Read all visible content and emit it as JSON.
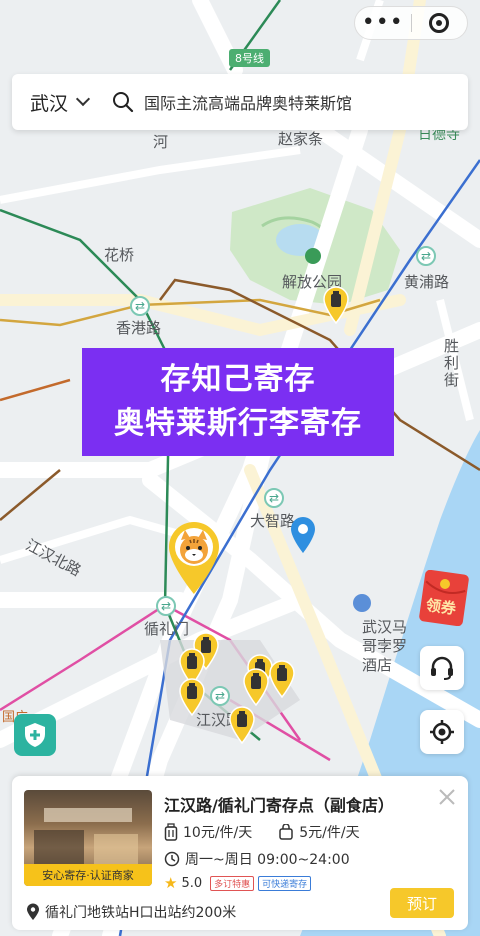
{
  "top_control": {
    "more_icon": "more-dots-icon",
    "close_icon": "target-circle-icon"
  },
  "search": {
    "city": "武汉",
    "query": "国际主流高端品牌奥特莱斯馆"
  },
  "map": {
    "labels": {
      "metro_line8": "8号线",
      "zhaojiatiao": "赵家条",
      "huaqiao": "花桥",
      "jiefang_park": "解放公园",
      "huangpu_road": "黄浦路",
      "xianggang_road": "香港路",
      "dazhi_road": "大智路",
      "jianghan_north": "江汉北路",
      "xunlimen": "循礼门",
      "jianghan_road": "江汉路",
      "wuhan_hotel": "武汉马哥孛罗酒店",
      "shengli_street": "胜利街",
      "river": "河",
      "left_guang": "国广",
      "right_top": "日德寺"
    }
  },
  "banner": {
    "line1": "存知己寄存",
    "line2": "奥特莱斯行李寄存"
  },
  "coupon": {
    "label": "领券"
  },
  "card": {
    "store_name": "江汉路/循礼门寄存点（副食店）",
    "cert_badge": "安心寄存·认证商家",
    "price_large": "10元/件/天",
    "price_small": "5元/件/天",
    "hours": "周一~周日 09:00~24:00",
    "rating": "5.0",
    "tag_discount": "多订特惠",
    "tag_fast": "可快递寄存",
    "address": "循礼门地铁站H口出站约200米",
    "book_label": "预订"
  },
  "colors": {
    "accent": "#f6c82a",
    "banner": "#7b2ff2",
    "teal": "#2cb3a0"
  }
}
